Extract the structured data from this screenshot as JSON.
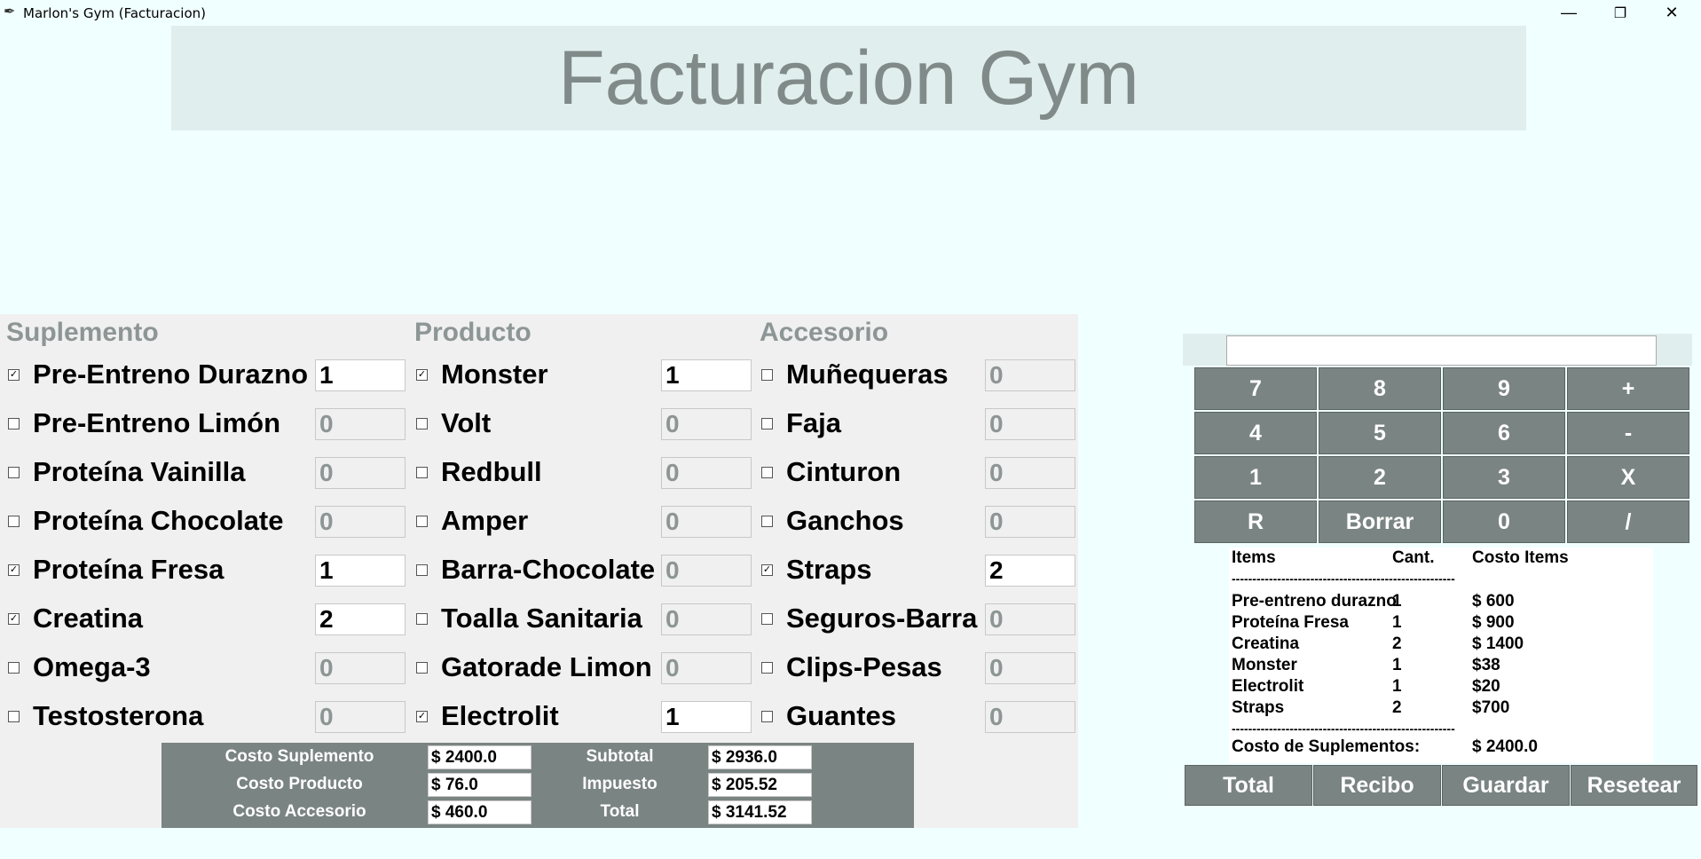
{
  "window": {
    "title": "Marlon's Gym (Facturacion)",
    "minimize_glyph": "—",
    "restore_glyph": "❐",
    "close_glyph": "✕"
  },
  "header": {
    "title": "Facturacion Gym"
  },
  "sections": {
    "suplemento": {
      "heading": "Suplemento",
      "items": [
        {
          "label": "Pre-Entreno Durazno",
          "checked": true,
          "qty": "1"
        },
        {
          "label": "Pre-Entreno Limón",
          "checked": false,
          "qty": "0"
        },
        {
          "label": "Proteína Vainilla",
          "checked": false,
          "qty": "0"
        },
        {
          "label": "Proteína Chocolate",
          "checked": false,
          "qty": "0"
        },
        {
          "label": "Proteína Fresa",
          "checked": true,
          "qty": "1"
        },
        {
          "label": "Creatina",
          "checked": true,
          "qty": "2"
        },
        {
          "label": "Omega-3",
          "checked": false,
          "qty": "0"
        },
        {
          "label": "Testosterona",
          "checked": false,
          "qty": "0"
        }
      ]
    },
    "producto": {
      "heading": "Producto",
      "items": [
        {
          "label": "Monster",
          "checked": true,
          "qty": "1"
        },
        {
          "label": "Volt",
          "checked": false,
          "qty": "0"
        },
        {
          "label": "Redbull",
          "checked": false,
          "qty": "0"
        },
        {
          "label": "Amper",
          "checked": false,
          "qty": "0"
        },
        {
          "label": "Barra-Chocolate",
          "checked": false,
          "qty": "0"
        },
        {
          "label": "Toalla Sanitaria",
          "checked": false,
          "qty": "0"
        },
        {
          "label": "Gatorade Limon",
          "checked": false,
          "qty": "0"
        },
        {
          "label": "Electrolit",
          "checked": true,
          "qty": "1"
        }
      ]
    },
    "accesorio": {
      "heading": "Accesorio",
      "items": [
        {
          "label": "Muñequeras",
          "checked": false,
          "qty": "0"
        },
        {
          "label": "Faja",
          "checked": false,
          "qty": "0"
        },
        {
          "label": "Cinturon",
          "checked": false,
          "qty": "0"
        },
        {
          "label": "Ganchos",
          "checked": false,
          "qty": "0"
        },
        {
          "label": "Straps",
          "checked": true,
          "qty": "2"
        },
        {
          "label": "Seguros-Barra",
          "checked": false,
          "qty": "0"
        },
        {
          "label": "Clips-Pesas",
          "checked": false,
          "qty": "0"
        },
        {
          "label": "Guantes",
          "checked": false,
          "qty": "0"
        }
      ]
    }
  },
  "costs": {
    "costo_suplemento_label": "Costo Suplemento",
    "costo_suplemento": "$ 2400.0",
    "costo_producto_label": "Costo Producto",
    "costo_producto": "$ 76.0",
    "costo_accesorio_label": "Costo Accesorio",
    "costo_accesorio": "$ 460.0",
    "subtotal_label": "Subtotal",
    "subtotal": "$ 2936.0",
    "impuesto_label": "Impuesto",
    "impuesto": "$ 205.52",
    "total_label": "Total",
    "total": "$ 3141.52"
  },
  "calculator": {
    "display": "",
    "keys": [
      "7",
      "8",
      "9",
      "+",
      "4",
      "5",
      "6",
      "-",
      "1",
      "2",
      "3",
      "X",
      "R",
      "Borrar",
      "0",
      "/"
    ]
  },
  "receipt": {
    "headers": {
      "items": "Items",
      "cant": "Cant.",
      "costo": "Costo Items"
    },
    "separator": "------------------------------------------------------",
    "rows": [
      {
        "item": "Pre-entreno durazno",
        "cant": "1",
        "costo": "$ 600"
      },
      {
        "item": "Proteína Fresa",
        "cant": "1",
        "costo": "$ 900"
      },
      {
        "item": "Creatina",
        "cant": "2",
        "costo": "$ 1400"
      },
      {
        "item": "Monster",
        "cant": "1",
        "costo": "$38"
      },
      {
        "item": "Electrolit",
        "cant": "1",
        "costo": "$20"
      },
      {
        "item": "Straps",
        "cant": "2",
        "costo": "$700"
      }
    ],
    "footer_label": "Costo de Suplementos:",
    "footer_value": "$ 2400.0"
  },
  "buttons": {
    "total": "Total",
    "recibo": "Recibo",
    "guardar": "Guardar",
    "resetear": "Resetear"
  },
  "colors": {
    "background": "#f0ffff",
    "panel": "#f0f0f0",
    "button": "#7a8482",
    "heading": "#8d9695"
  }
}
